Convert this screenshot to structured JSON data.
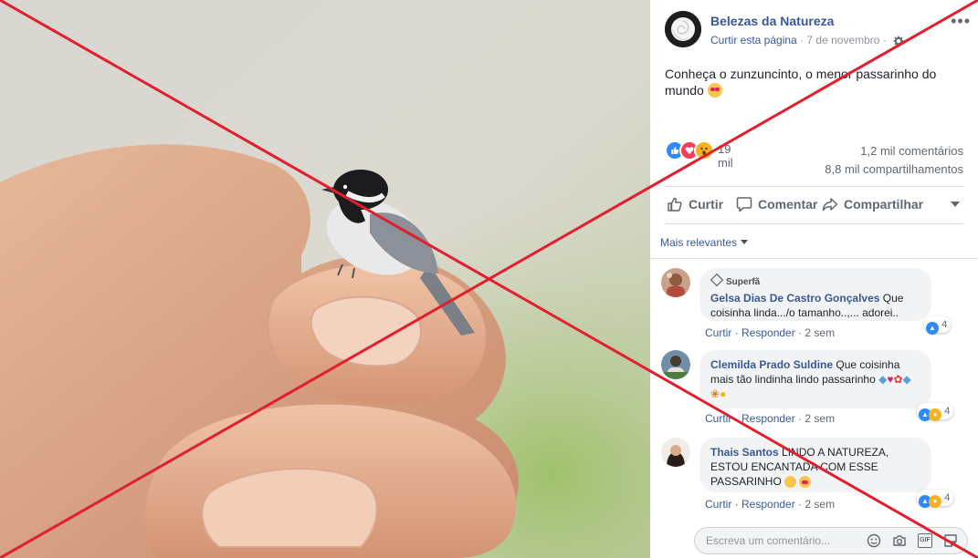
{
  "page": {
    "name": "Belezas da Natureza",
    "like_page_label": "Curtir esta página",
    "separator": "·",
    "date": "7 de novembro",
    "more_label": "•••"
  },
  "post": {
    "text": "Conheça o zunzuncinto, o menor passarinho do mundo",
    "reaction_count": "19 mil",
    "comments_count": "1,2 mil comentários",
    "shares_count": "8,8 mil compartilhamentos"
  },
  "actions": {
    "like": "Curtir",
    "comment": "Comentar",
    "share": "Compartilhar"
  },
  "sort_label": "Mais relevantes",
  "comments": [
    {
      "badge": "Superfã",
      "author": "Gelsa Dias De Castro Gonçalves",
      "text": " Que coisinha linda.../o tamanho..,... adorei..",
      "like": "Curtir",
      "reply": "Responder",
      "time": "2 sem",
      "reactions": "4"
    },
    {
      "author": "Clemilda Prado Suldine",
      "text": " Que coisinha mais tão lindinha lindo passarinho",
      "like": "Curtir",
      "reply": "Responder",
      "time": "2 sem",
      "reactions": "4"
    },
    {
      "author": "Thais Santos",
      "text": " LINDO A NATUREZA, ESTOU ENCANTADA COM ESSE PASSARINHO",
      "like": "Curtir",
      "reply": "Responder",
      "time": "2 sem",
      "reactions": "4"
    }
  ],
  "composer": {
    "placeholder": "Escreva um comentário..."
  },
  "colors": {
    "link": "#385898",
    "overlay_cross": "#e0202e"
  }
}
